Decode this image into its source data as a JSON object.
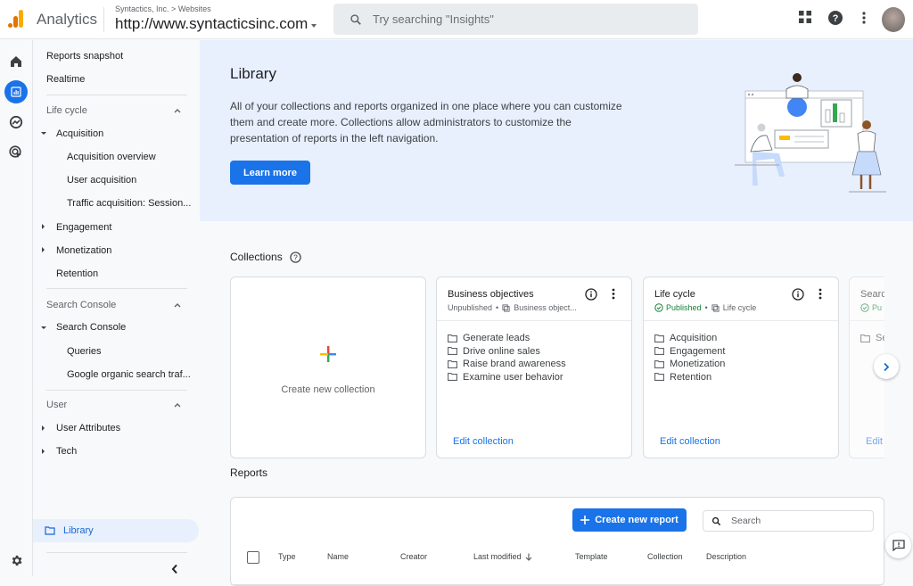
{
  "header": {
    "app_name": "Analytics",
    "breadcrumb_account": "Syntactics, Inc.",
    "breadcrumb_sep": ">",
    "breadcrumb_property_group": "Websites",
    "property_name": "http://www.syntacticsinc.com",
    "search_placeholder": "Try searching \"Insights\""
  },
  "rail": {
    "items": [
      {
        "icon": "home-icon",
        "label": "Home"
      },
      {
        "icon": "reports-icon",
        "label": "Reports",
        "active": true
      },
      {
        "icon": "explore-icon",
        "label": "Explore"
      },
      {
        "icon": "advertising-icon",
        "label": "Advertising"
      }
    ]
  },
  "sidenav": {
    "top_items": [
      "Reports snapshot",
      "Realtime"
    ],
    "sections": [
      {
        "title": "Life cycle",
        "items": [
          {
            "label": "Acquisition",
            "expanded": true,
            "children": [
              "Acquisition overview",
              "User acquisition",
              "Traffic acquisition: Session..."
            ]
          },
          {
            "label": "Engagement",
            "expanded": false
          },
          {
            "label": "Monetization",
            "expanded": false
          },
          {
            "label": "Retention"
          }
        ]
      },
      {
        "title": "Search Console",
        "items": [
          {
            "label": "Search Console",
            "expanded": true,
            "children": [
              "Queries",
              "Google organic search traf..."
            ]
          }
        ]
      },
      {
        "title": "User",
        "items": [
          {
            "label": "User Attributes",
            "expanded": false
          },
          {
            "label": "Tech",
            "expanded": false
          }
        ]
      }
    ],
    "library_label": "Library"
  },
  "hero": {
    "title": "Library",
    "description": "All of your collections and reports organized in one place where you can customize them and create more. Collections allow administrators to customize the presentation of reports in the left navigation.",
    "learn_more": "Learn more"
  },
  "collections": {
    "title": "Collections",
    "create_label": "Create new collection",
    "cards": [
      {
        "title": "Business objectives",
        "status": "Unpublished",
        "template": "Business object...",
        "items": [
          "Generate leads",
          "Drive online sales",
          "Raise brand awareness",
          "Examine user behavior"
        ],
        "edit_label": "Edit collection"
      },
      {
        "title": "Life cycle",
        "status": "Published",
        "template": "Life cycle",
        "items": [
          "Acquisition",
          "Engagement",
          "Monetization",
          "Retention"
        ],
        "edit_label": "Edit collection"
      },
      {
        "title": "Searc",
        "status": "Pu",
        "items": [
          "Se"
        ],
        "edit_label": "Edit"
      }
    ]
  },
  "reports": {
    "title": "Reports",
    "create_label": "Create new report",
    "search_placeholder": "Search",
    "columns": [
      "Type",
      "Name",
      "Creator",
      "Last modified",
      "Template",
      "Collection",
      "Description"
    ],
    "sort_column": "Last modified",
    "sort_direction": "descending"
  },
  "colors": {
    "accent": "#1a73e8",
    "hero_bg": "#e8f0fe",
    "published": "#188038",
    "logo_orange": "#f9ab00",
    "logo_dark_orange": "#e37400"
  }
}
